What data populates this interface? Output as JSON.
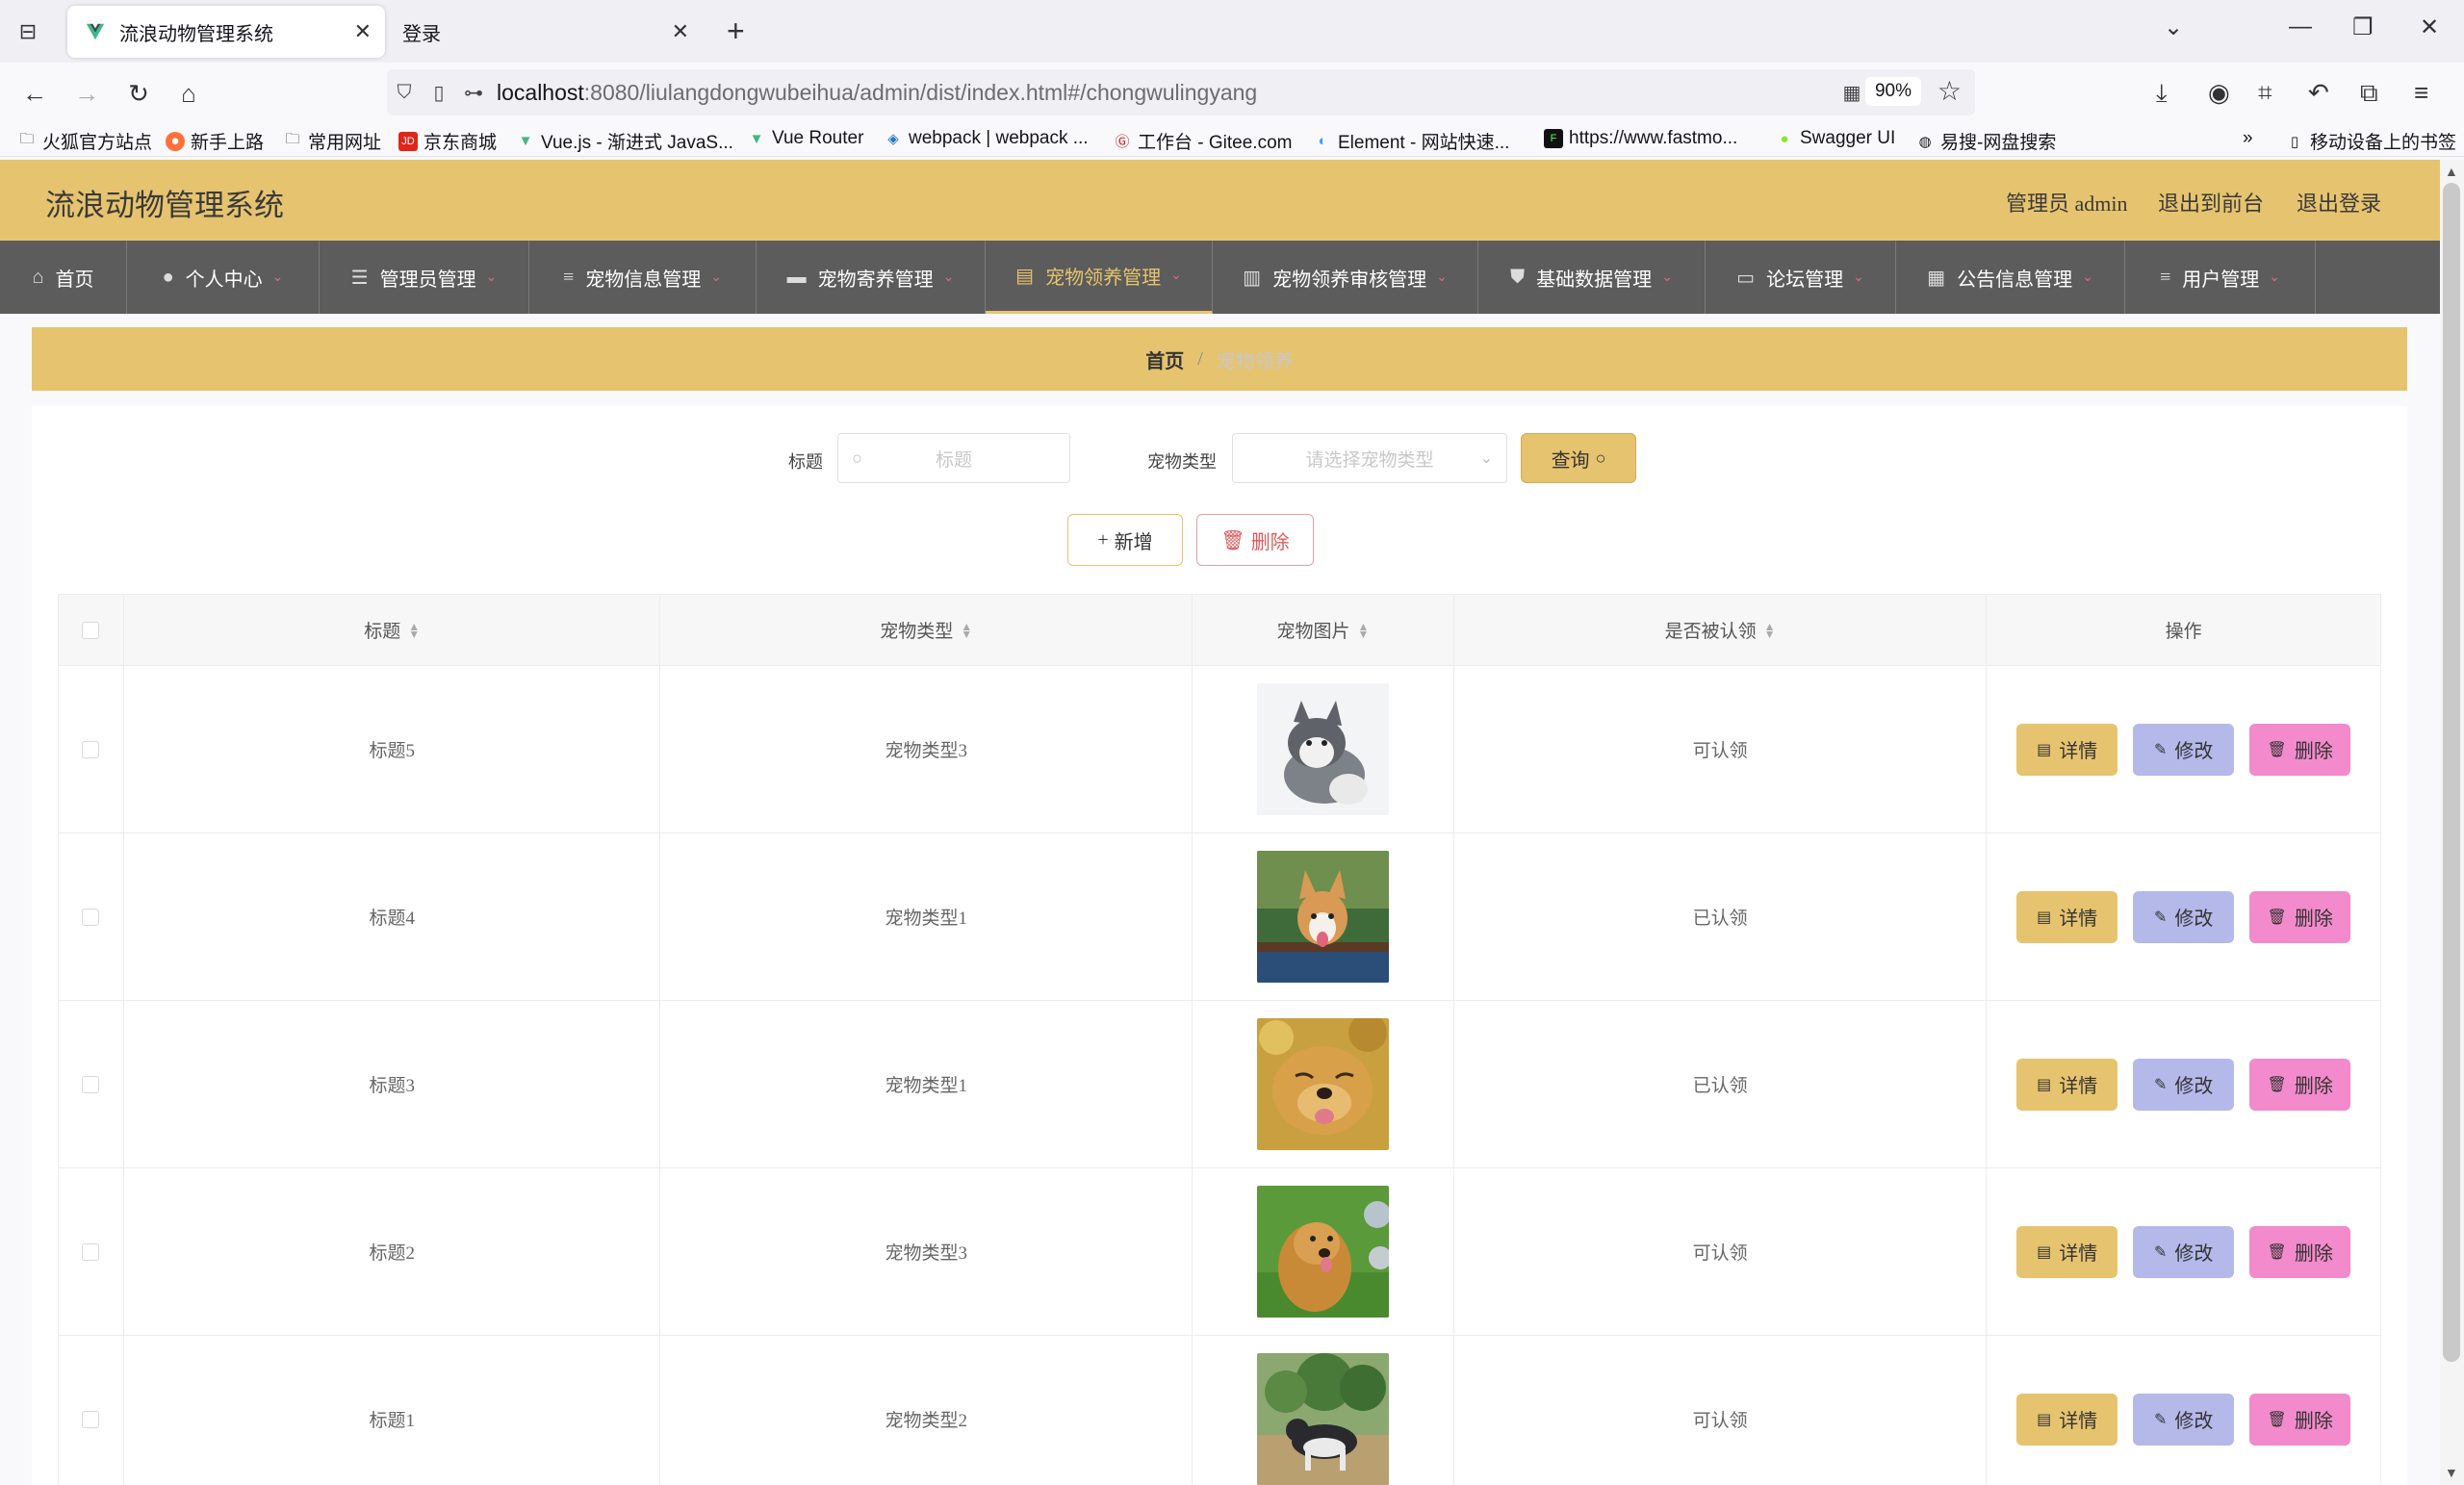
{
  "browser": {
    "tabs": [
      {
        "title": "流浪动物管理系统",
        "active": true
      },
      {
        "title": "登录",
        "active": false
      }
    ],
    "url_host": "localhost",
    "url_rest": ":8080/liulangdongwubeihua/admin/dist/index.html#/chongwulingyang",
    "zoom": "90%",
    "bookmarks": [
      "火狐官方站点",
      "新手上路",
      "常用网址",
      "京东商城",
      "Vue.js - 渐进式 JavaS...",
      "Vue Router",
      "webpack | webpack ...",
      "工作台 - Gitee.com",
      "Element - 网站快速...",
      "https://www.fastmo...",
      "Swagger UI",
      "易搜-网盘搜索"
    ],
    "mobile_bookmarks": "移动设备上的书签"
  },
  "header": {
    "title": "流浪动物管理系统",
    "user": "管理员 admin",
    "to_front": "退出到前台",
    "logout": "退出登录"
  },
  "menu": [
    {
      "label": "首页",
      "icon": "home-icon",
      "caret": false
    },
    {
      "label": "个人中心",
      "icon": "user-icon",
      "caret": true
    },
    {
      "label": "管理员管理",
      "icon": "sliders-icon",
      "caret": true
    },
    {
      "label": "宠物信息管理",
      "icon": "list-icon",
      "caret": true
    },
    {
      "label": "宠物寄养管理",
      "icon": "ticket-icon",
      "caret": true
    },
    {
      "label": "宠物领养管理",
      "icon": "clipboard-icon",
      "caret": true,
      "active": true
    },
    {
      "label": "宠物领养审核管理",
      "icon": "book-icon",
      "caret": true
    },
    {
      "label": "基础数据管理",
      "icon": "stamp-icon",
      "caret": true
    },
    {
      "label": "论坛管理",
      "icon": "monitor-icon",
      "caret": true
    },
    {
      "label": "公告信息管理",
      "icon": "briefcase-icon",
      "caret": true
    },
    {
      "label": "用户管理",
      "icon": "menu-icon",
      "caret": true
    }
  ],
  "breadcrumb": {
    "home": "首页",
    "current": "宠物领养"
  },
  "search": {
    "title_label": "标题",
    "title_placeholder": "标题",
    "type_label": "宠物类型",
    "type_placeholder": "请选择宠物类型",
    "query_label": "查询"
  },
  "actions": {
    "add": "新增",
    "delete": "删除"
  },
  "table": {
    "columns": [
      "标题",
      "宠物类型",
      "宠物图片",
      "是否被认领",
      "操作"
    ],
    "rows": [
      {
        "title": "标题5",
        "type": "宠物类型3",
        "status": "可认领",
        "photo": "husky-puppy"
      },
      {
        "title": "标题4",
        "type": "宠物类型1",
        "status": "已认领",
        "photo": "corgi"
      },
      {
        "title": "标题3",
        "type": "宠物类型1",
        "status": "已认领",
        "photo": "golden-retriever-smile"
      },
      {
        "title": "标题2",
        "type": "宠物类型3",
        "status": "可认领",
        "photo": "golden-retriever-grass"
      },
      {
        "title": "标题1",
        "type": "宠物类型2",
        "status": "可认领",
        "photo": "husky-outdoor"
      }
    ],
    "op_detail": "详情",
    "op_edit": "修改",
    "op_delete": "删除"
  },
  "colors": {
    "accent": "#e6c36e",
    "menu_bg": "#5c5c5c",
    "edit": "#b4b9ea",
    "delete": "#f28acb"
  }
}
